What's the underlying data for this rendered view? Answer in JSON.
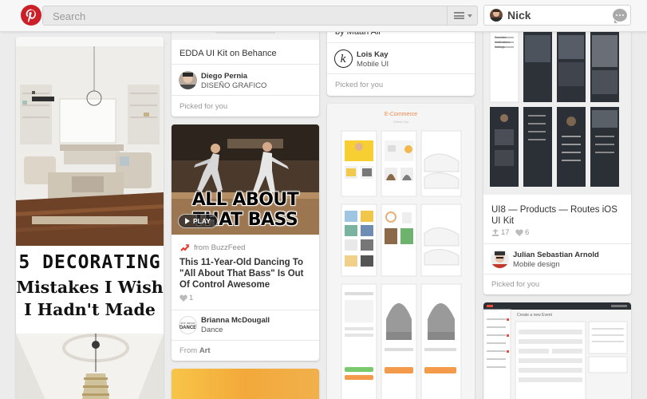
{
  "header": {
    "search_placeholder": "Search",
    "user_name": "Nick",
    "brand_color": "#cb2027"
  },
  "icons": [
    "pinterest-logo-icon",
    "menu-icon",
    "chevron-down-icon",
    "messages-icon",
    "heart-icon",
    "repin-icon",
    "buzzfeed-icon"
  ],
  "col2": {
    "pin_top": {
      "title": "EDDA UI Kit on Behance",
      "pinner": "Diego Pernia",
      "board": "DISEÑO GRAFICO",
      "footer": "Picked for you"
    },
    "pin_video": {
      "image_text": "ALL ABOUT THAT BASS",
      "play_label": "PLAY",
      "source": "from BuzzFeed",
      "title": "This 11-Year-Old Dancing To \"All About That Bass\" Is Out Of Control Awesome",
      "likes": "1",
      "pinner": "Brianna McDougall",
      "board": "Dance",
      "footer_prefix": "From",
      "footer_board": "Art"
    }
  },
  "col1": {
    "headline_1": "5 DECORATING",
    "headline_2": "Mistakes I Wish",
    "headline_3": "I Hadn't Made"
  },
  "col3": {
    "pin_top": {
      "partial_title": "by Maan Ali",
      "pinner": "Lois Kay",
      "board": "Mobile UI",
      "footer": "Picked for you"
    },
    "pin_ecommerce": {
      "image_title": "E-Commerce"
    }
  },
  "col4": {
    "pin_ui8": {
      "title": "UI8 — Products — Routes iOS UI Kit",
      "repins": "17",
      "likes": "6",
      "pinner": "Julian Sebastian Arnold",
      "board": "Mobile design",
      "footer": "Picked for you",
      "image_menu": [
        "Favorites",
        "Notifications",
        "Settings"
      ]
    },
    "pin_event": {
      "image_title": "Create a new Event"
    }
  }
}
